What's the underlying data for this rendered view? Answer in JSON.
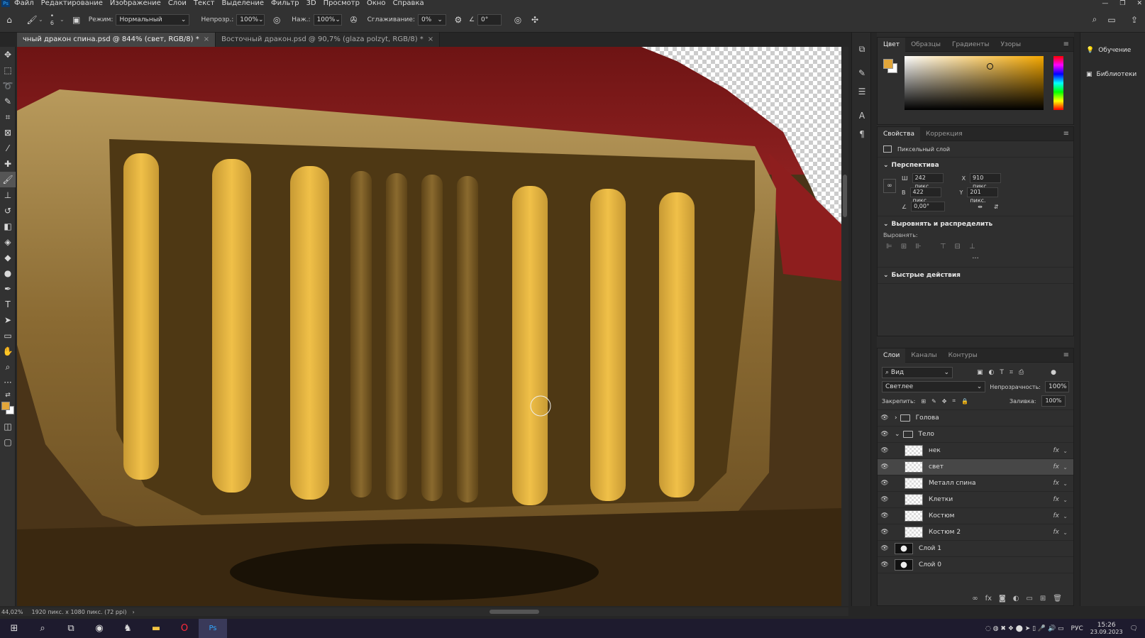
{
  "menu": {
    "app_icon": "Ps",
    "items": [
      "Файл",
      "Редактирование",
      "Изображение",
      "Слои",
      "Текст",
      "Выделение",
      "Фильтр",
      "3D",
      "Просмотр",
      "Окно",
      "Справка"
    ]
  },
  "options": {
    "brush_size": "6",
    "mode_label": "Режим:",
    "mode_value": "Нормальный",
    "opacity_label": "Непрозр.:",
    "opacity_value": "100%",
    "pressure_label": "Наж.:",
    "pressure_value": "100%",
    "smoothing_label": "Сглаживание:",
    "smoothing_value": "0%",
    "angle_value": "0°"
  },
  "tabs": [
    {
      "label": "чный дракон спина.psd @ 844% (свет, RGB/8) *",
      "active": true
    },
    {
      "label": "Восточный дракон.psd @ 90,7% (glaza polzyt, RGB/8) *",
      "active": false
    }
  ],
  "status": {
    "zoom": "44,02%",
    "doc_info": "1920 пикс. x 1080 пикс. (72 ppi)"
  },
  "color_panel": {
    "tabs": [
      "Цвет",
      "Образцы",
      "Градиенты",
      "Узоры"
    ],
    "foreground": "#e2a63a",
    "background": "#ffffff"
  },
  "properties_panel": {
    "tabs": [
      "Свойства",
      "Коррекция"
    ],
    "layer_type": "Пиксельный слой",
    "transform": {
      "title": "Перспектива",
      "w_label": "Ш",
      "w_value": "242 пикс.",
      "h_label": "В",
      "h_value": "422 пикс.",
      "x_label": "X",
      "x_value": "910 пикс.",
      "y_label": "Y",
      "y_value": "201 пикс.",
      "angle_value": "0,00°"
    },
    "align": {
      "title": "Выровнять и распределить",
      "sub": "Выровнять:"
    },
    "quick_actions": "Быстрые действия"
  },
  "layers_panel": {
    "tabs": [
      "Слои",
      "Каналы",
      "Контуры"
    ],
    "filter_label": "Вид",
    "blend_mode": "Светлее",
    "opacity_label": "Непрозрачность:",
    "opacity_value": "100%",
    "lock_label": "Закрепить:",
    "fill_label": "Заливка:",
    "fill_value": "100%",
    "layers": [
      {
        "name": "Голова",
        "kind": "group",
        "indent": 0,
        "fx": false,
        "selected": false
      },
      {
        "name": "Тело",
        "kind": "group-open",
        "indent": 0,
        "fx": false,
        "selected": false
      },
      {
        "name": "нек",
        "kind": "pixel",
        "indent": 1,
        "fx": true,
        "selected": false
      },
      {
        "name": "свет",
        "kind": "pixel",
        "indent": 1,
        "fx": true,
        "selected": true
      },
      {
        "name": "Металл спина",
        "kind": "pixel",
        "indent": 1,
        "fx": true,
        "selected": false
      },
      {
        "name": "Клетки",
        "kind": "pixel",
        "indent": 1,
        "fx": true,
        "selected": false
      },
      {
        "name": "Костюм",
        "kind": "pixel",
        "indent": 1,
        "fx": true,
        "selected": false
      },
      {
        "name": "Костюм 2",
        "kind": "pixel",
        "indent": 1,
        "fx": true,
        "selected": false
      },
      {
        "name": "Слой 1",
        "kind": "dark",
        "indent": 0,
        "fx": false,
        "selected": false
      },
      {
        "name": "Слой 0",
        "kind": "dark",
        "indent": 0,
        "fx": false,
        "selected": false
      }
    ]
  },
  "right_panel": {
    "learn": "Обучение",
    "libraries": "Библиотеки"
  },
  "taskbar": {
    "lang": "РУС",
    "time": "15:26",
    "date": "23.09.2023"
  }
}
